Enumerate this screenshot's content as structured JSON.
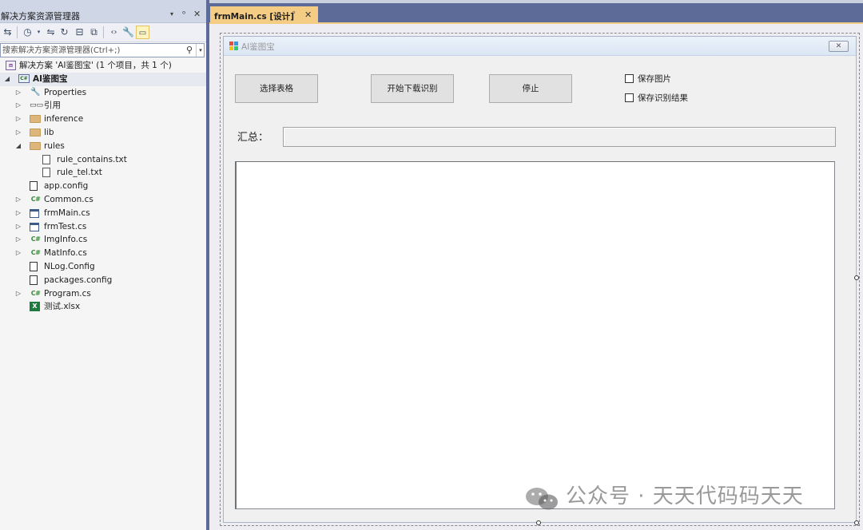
{
  "solution_explorer": {
    "title": "解决方案资源管理器",
    "title_glyphs": [
      "▾",
      "ᵒ",
      "✕"
    ],
    "toolbar_icons": [
      "sync-with-document-icon",
      "history-icon",
      "switch-views-icon",
      "refresh-icon",
      "collapse-all-icon",
      "show-all-files-icon",
      "code-view-icon",
      "properties-wrench-icon",
      "preview-selected-icon"
    ],
    "search_placeholder": "搜索解决方案资源管理器(Ctrl+;)",
    "tree": [
      {
        "label": "解决方案 'AI鉴图宝' (1 个项目，共 1 个)",
        "icon": "solution-icon",
        "level": 0,
        "expander": ""
      },
      {
        "label": "AI鉴图宝",
        "icon": "csharp-project-icon",
        "level": 0,
        "expander": "◢",
        "bold": true,
        "selected": true
      },
      {
        "label": "Properties",
        "icon": "wrench-icon",
        "level": 1,
        "expander": "▷"
      },
      {
        "label": "引用",
        "icon": "references-icon",
        "level": 1,
        "expander": "▷"
      },
      {
        "label": "inference",
        "icon": "folder-icon",
        "level": 1,
        "expander": "▷"
      },
      {
        "label": "lib",
        "icon": "folder-icon",
        "level": 1,
        "expander": "▷"
      },
      {
        "label": "rules",
        "icon": "folder-icon",
        "level": 1,
        "expander": "◢"
      },
      {
        "label": "rule_contains.txt",
        "icon": "text-file-icon",
        "level": 2,
        "expander": ""
      },
      {
        "label": "rule_tel.txt",
        "icon": "text-file-icon",
        "level": 2,
        "expander": ""
      },
      {
        "label": "app.config",
        "icon": "config-file-icon",
        "level": 1,
        "expander": ""
      },
      {
        "label": "Common.cs",
        "icon": "csharp-file-icon",
        "level": 1,
        "expander": "▷"
      },
      {
        "label": "frmMain.cs",
        "icon": "form-file-icon",
        "level": 1,
        "expander": "▷"
      },
      {
        "label": "frmTest.cs",
        "icon": "form-file-icon",
        "level": 1,
        "expander": "▷"
      },
      {
        "label": "ImgInfo.cs",
        "icon": "csharp-file-icon",
        "level": 1,
        "expander": "▷"
      },
      {
        "label": "MatInfo.cs",
        "icon": "csharp-file-icon",
        "level": 1,
        "expander": "▷"
      },
      {
        "label": "NLog.Config",
        "icon": "config-file-icon",
        "level": 1,
        "expander": ""
      },
      {
        "label": "packages.config",
        "icon": "config-file-icon",
        "level": 1,
        "expander": ""
      },
      {
        "label": "Program.cs",
        "icon": "csharp-file-icon",
        "level": 1,
        "expander": "▷"
      },
      {
        "label": "测试.xlsx",
        "icon": "excel-file-icon",
        "level": 1,
        "expander": ""
      }
    ]
  },
  "document_tab": {
    "label": "frmMain.cs [设计]",
    "pin": "ᵒ",
    "close": "✕"
  },
  "form": {
    "title": "AI鉴图宝",
    "close": "✕",
    "buttons": {
      "select_sheet": "选择表格",
      "start_download": "开始下载识别",
      "stop": "停止"
    },
    "checkboxes": {
      "save_image": {
        "label": "保存图片",
        "checked": false
      },
      "save_result": {
        "label": "保存识别结果",
        "checked": false
      }
    },
    "summary_label": "汇总：",
    "summary_value": ""
  },
  "watermark": {
    "text": "公众号 · 天天代码码天天"
  },
  "colors": {
    "vs_chrome": "#5d6b99",
    "active_tab": "#f5cc84",
    "panel_background": "#f5f5f5",
    "csharp_green": "#3a8a3a",
    "folder": "#dcb67a"
  }
}
